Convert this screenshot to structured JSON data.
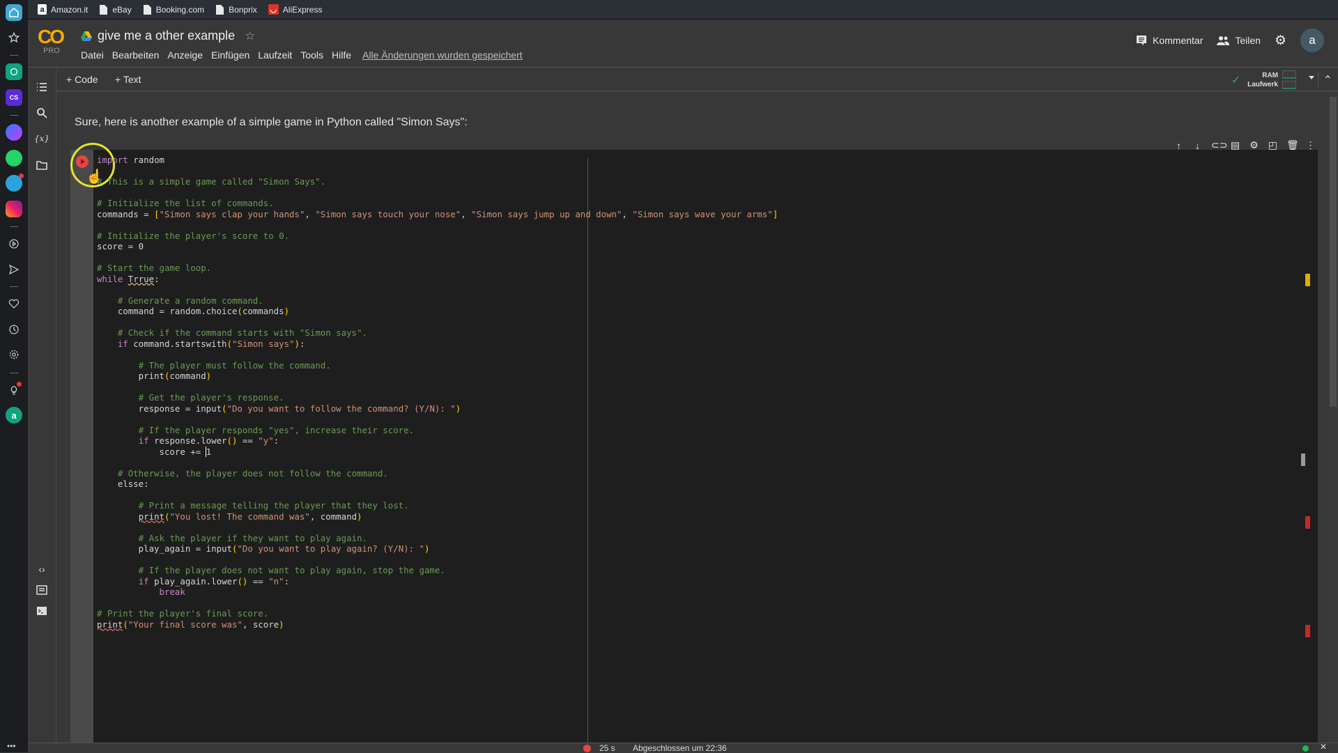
{
  "bookmarks": [
    {
      "label": "Amazon.it",
      "icon": "amazon-icon"
    },
    {
      "label": "eBay",
      "icon": "page-icon"
    },
    {
      "label": "Booking.com",
      "icon": "page-icon"
    },
    {
      "label": "Bonprix",
      "icon": "page-icon"
    },
    {
      "label": "AliExpress",
      "icon": "aliexpress-icon"
    }
  ],
  "app": {
    "logo_text": "CO",
    "logo_sub": "PRO",
    "title": "give me a other example",
    "menu": [
      "Datei",
      "Bearbeiten",
      "Anzeige",
      "Einfügen",
      "Laufzeit",
      "Tools",
      "Hilfe"
    ],
    "saved_status": "Alle Änderungen wurden gespeichert",
    "comment_label": "Kommentar",
    "share_label": "Teilen",
    "avatar_letter": "a"
  },
  "toolbar": {
    "add_code": "+ Code",
    "add_text": "+ Text",
    "ram_label": "RAM",
    "disk_label": "Laufwerk"
  },
  "cell_toolbar": [
    "move-up",
    "move-down",
    "link",
    "comment",
    "settings",
    "mirror",
    "delete",
    "more"
  ],
  "notebook": {
    "text_cell": "Sure, here is another example of a simple game in Python called \"Simon Says\":",
    "code_lines": [
      "import random",
      "",
      "# This is a simple game called \"Simon Says\".",
      "",
      "# Initialize the list of commands.",
      "commands = [\"Simon says clap your hands\", \"Simon says touch your nose\", \"Simon says jump up and down\", \"Simon says wave your arms\"]",
      "",
      "# Initialize the player's score to 0.",
      "score = 0",
      "",
      "# Start the game loop.",
      "while Trrue:",
      "",
      "    # Generate a random command.",
      "    command = random.choice(commands)",
      "",
      "    # Check if the command starts with \"Simon says\".",
      "    if command.startswith(\"Simon says\"):",
      "",
      "        # The player must follow the command.",
      "        print(command)",
      "",
      "        # Get the player's response.",
      "        response = input(\"Do you want to follow the command? (Y/N): \")",
      "",
      "        # If the player responds \"yes\", increase their score.",
      "        if response.lower() == \"y\":",
      "            score += 1",
      "",
      "    # Otherwise, the player does not follow the command.",
      "    elsse:",
      "",
      "        # Print a message telling the player that they lost.",
      "        print(\"You lost! The command was\", command)",
      "",
      "        # Ask the player if they want to play again.",
      "        play_again = input(\"Do you want to play again? (Y/N): \")",
      "",
      "        # If the player does not want to play again, stop the game.",
      "        if play_again.lower() == \"n\":",
      "            break",
      "",
      "# Print the player's final score.",
      "print(\"Your final score was\", score)"
    ]
  },
  "status": {
    "duration": "25 s",
    "text": "Abgeschlossen um 22:36"
  },
  "colors": {
    "accent": "#f9ab00",
    "error": "#e84545",
    "ok": "#34a853"
  }
}
